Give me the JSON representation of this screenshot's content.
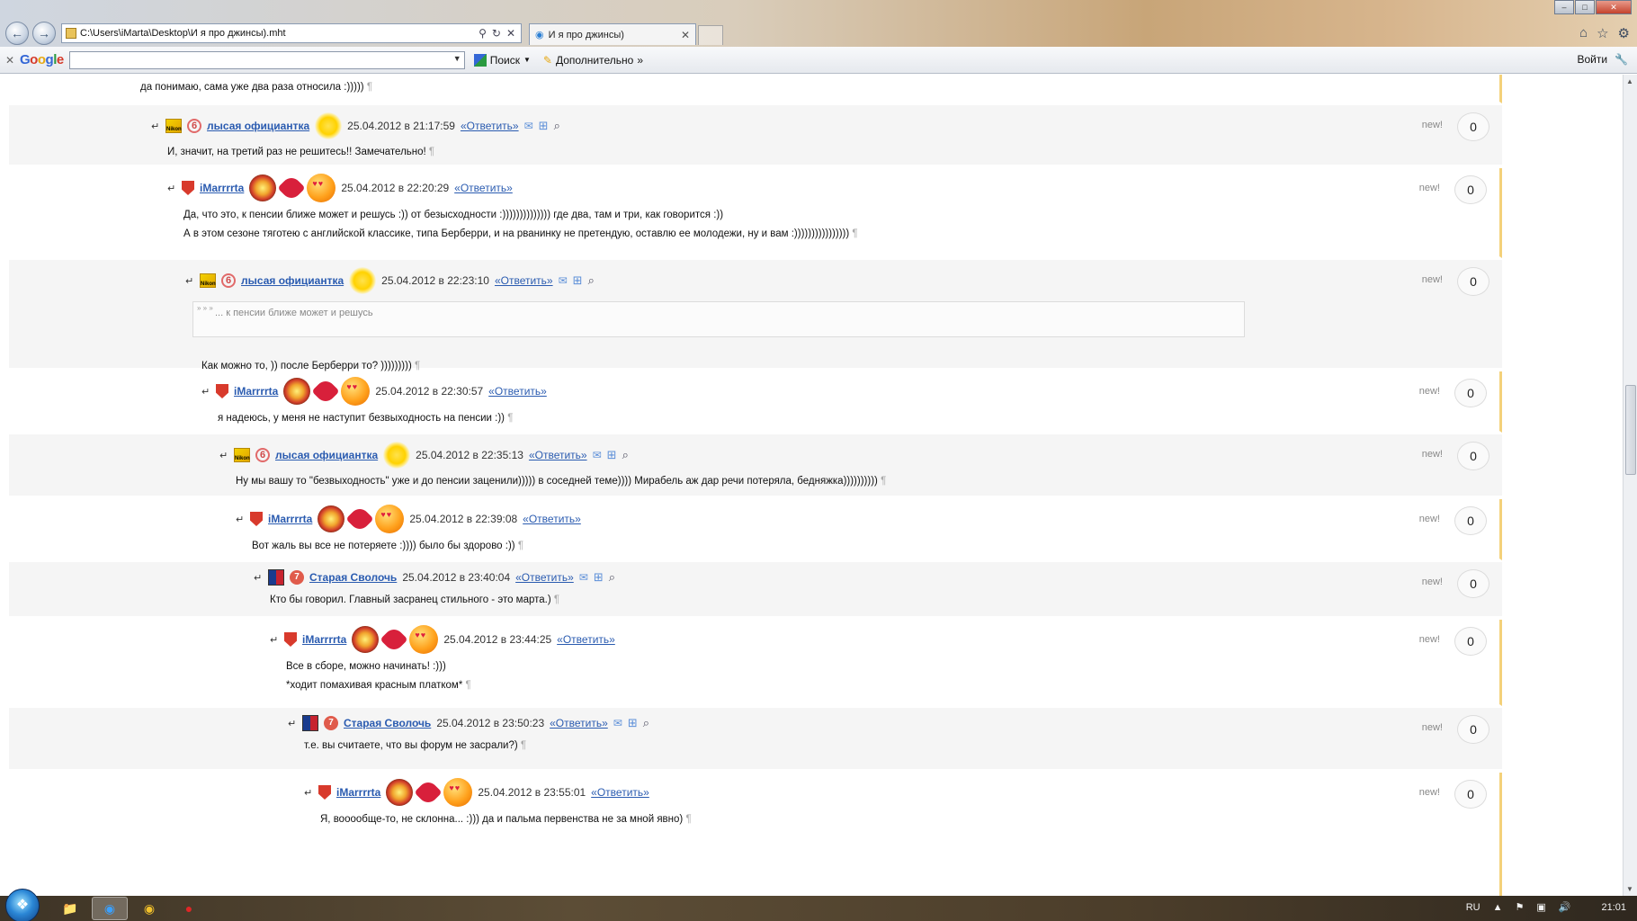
{
  "browser": {
    "address": "C:\\Users\\iMarta\\Desktop\\И я про джинсы).mht",
    "tab_title": "И я про джинсы)",
    "google_toolbar": {
      "logo": "Google",
      "search_label": "Поиск",
      "more_label": "Дополнительно",
      "login_label": "Войти"
    }
  },
  "page": {
    "top_line": "да понимаю, сама уже два раза относила :)))))",
    "reply_label": "«Ответить»",
    "new_label": "new!",
    "quote_text": "... к пенсии ближе может и решусь",
    "comments": [
      {
        "user": "лысая официантка",
        "date": "25.04.2012 в 21:17:59",
        "lines": [
          "И, значит, на третий раз не решитесь!! Замечательно!"
        ],
        "votes": "0"
      },
      {
        "user": "iMarrrrta",
        "date": "25.04.2012 в 22:20:29",
        "lines": [
          "Да, что это, к пенсии ближе может и решусь :)) от безысходности :)))))))))))))) где два, там и три, как говорится :))",
          "А в этом сезоне тяготею с английской классике, типа Берберри, и на рванинку не претендую, оставлю ее молодежи, ну и вам :))))))))))))))))"
        ],
        "votes": "0"
      },
      {
        "user": "лысая официантка",
        "date": "25.04.2012 в 22:23:10",
        "lines": [
          "Как можно то, )) после Берберри то? )))))))))"
        ],
        "votes": "0"
      },
      {
        "user": "iMarrrrta",
        "date": "25.04.2012 в 22:30:57",
        "lines": [
          "я надеюсь, у меня не наступит безвыходность на пенсии :))"
        ],
        "votes": "0"
      },
      {
        "user": "лысая официантка",
        "date": "25.04.2012 в 22:35:13",
        "lines": [
          "Ну мы вашу то \"безвыходность\" уже и до пенсии заценили))))) в соседней теме)))) Мирабель аж дар речи потеряла, бедняжка))))))))))"
        ],
        "votes": "0"
      },
      {
        "user": "iMarrrrta",
        "date": "25.04.2012 в 22:39:08",
        "lines": [
          "Вот жаль вы все не потеряете :)))) было бы здорово :))"
        ],
        "votes": "0"
      },
      {
        "user": "Старая Сволочь",
        "date": "25.04.2012 в 23:40:04",
        "lines": [
          "Кто бы говорил. Главный засранец стильного - это марта.)"
        ],
        "votes": "0"
      },
      {
        "user": "iMarrrrta",
        "date": "25.04.2012 в 23:44:25",
        "lines": [
          "Все в сборе, можно начинать! :)))",
          "*ходит помахивая красным платком*"
        ],
        "votes": "0"
      },
      {
        "user": "Старая Сволочь",
        "date": "25.04.2012 в 23:50:23",
        "lines": [
          "т.е. вы считаете, что вы форум не засрали?)"
        ],
        "votes": "0"
      },
      {
        "user": "iMarrrrta",
        "date": "25.04.2012 в 23:55:01",
        "lines": [
          "Я, вооообще-то, не склонна... :))) да и пальма первенства не за мной явно)"
        ],
        "votes": "0"
      }
    ]
  },
  "taskbar": {
    "lang": "RU",
    "clock": "21:01"
  },
  "colors": {
    "link": "#2a5bb0",
    "marker": "#f4d17a",
    "row_grey": "#f5f5f5"
  }
}
